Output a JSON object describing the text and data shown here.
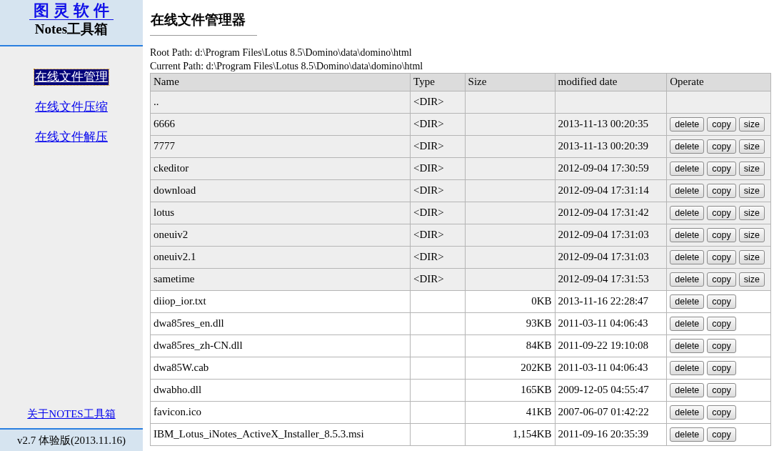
{
  "sidebar": {
    "logo": "图灵软件",
    "subtitle": "Notes工具箱",
    "items": [
      {
        "label": "在线文件管理",
        "selected": true
      },
      {
        "label": "在线文件压缩",
        "selected": false
      },
      {
        "label": "在线文件解压",
        "selected": false
      }
    ],
    "about_link": "关于NOTES工具箱",
    "version": "v2.7 体验版(2013.11.16)"
  },
  "page_title": "在线文件管理器",
  "root_path": "Root Path: d:\\Program Files\\Lotus 8.5\\Domino\\data\\domino\\html",
  "current_path": "Current Path: d:\\Program Files\\Lotus 8.5\\Domino\\data\\domino\\html",
  "table": {
    "columns": [
      "Name",
      "Type",
      "Size",
      "modified date",
      "Operate"
    ],
    "rows": [
      {
        "kind": "dir",
        "name": "..",
        "type": "<DIR>",
        "size": "",
        "date": "",
        "actions": []
      },
      {
        "kind": "dir",
        "name": "6666",
        "type": "<DIR>",
        "size": "",
        "date": "2013-11-13 00:20:35",
        "actions": [
          "delete",
          "copy",
          "size"
        ]
      },
      {
        "kind": "dir",
        "name": "7777",
        "type": "<DIR>",
        "size": "",
        "date": "2013-11-13 00:20:39",
        "actions": [
          "delete",
          "copy",
          "size"
        ]
      },
      {
        "kind": "dir",
        "name": "ckeditor",
        "type": "<DIR>",
        "size": "",
        "date": "2012-09-04 17:30:59",
        "actions": [
          "delete",
          "copy",
          "size"
        ]
      },
      {
        "kind": "dir",
        "name": "download",
        "type": "<DIR>",
        "size": "",
        "date": "2012-09-04 17:31:14",
        "actions": [
          "delete",
          "copy",
          "size"
        ]
      },
      {
        "kind": "dir",
        "name": "lotus",
        "type": "<DIR>",
        "size": "",
        "date": "2012-09-04 17:31:42",
        "actions": [
          "delete",
          "copy",
          "size"
        ]
      },
      {
        "kind": "dir",
        "name": "oneuiv2",
        "type": "<DIR>",
        "size": "",
        "date": "2012-09-04 17:31:03",
        "actions": [
          "delete",
          "copy",
          "size"
        ]
      },
      {
        "kind": "dir",
        "name": "oneuiv2.1",
        "type": "<DIR>",
        "size": "",
        "date": "2012-09-04 17:31:03",
        "actions": [
          "delete",
          "copy",
          "size"
        ]
      },
      {
        "kind": "dir",
        "name": "sametime",
        "type": "<DIR>",
        "size": "",
        "date": "2012-09-04 17:31:53",
        "actions": [
          "delete",
          "copy",
          "size"
        ]
      },
      {
        "kind": "file",
        "name": "diiop_ior.txt",
        "type": "",
        "size": "0KB",
        "date": "2013-11-16 22:28:47",
        "actions": [
          "delete",
          "copy"
        ]
      },
      {
        "kind": "file",
        "name": "dwa85res_en.dll",
        "type": "",
        "size": "93KB",
        "date": "2011-03-11 04:06:43",
        "actions": [
          "delete",
          "copy"
        ]
      },
      {
        "kind": "file",
        "name": "dwa85res_zh-CN.dll",
        "type": "",
        "size": "84KB",
        "date": "2011-09-22 19:10:08",
        "actions": [
          "delete",
          "copy"
        ]
      },
      {
        "kind": "file",
        "name": "dwa85W.cab",
        "type": "",
        "size": "202KB",
        "date": "2011-03-11 04:06:43",
        "actions": [
          "delete",
          "copy"
        ]
      },
      {
        "kind": "file",
        "name": "dwabho.dll",
        "type": "",
        "size": "165KB",
        "date": "2009-12-05 04:55:47",
        "actions": [
          "delete",
          "copy"
        ]
      },
      {
        "kind": "file",
        "name": "favicon.ico",
        "type": "",
        "size": "41KB",
        "date": "2007-06-07 01:42:22",
        "actions": [
          "delete",
          "copy"
        ]
      },
      {
        "kind": "file",
        "name": "IBM_Lotus_iNotes_ActiveX_Installer_8.5.3.msi",
        "type": "",
        "size": "1,154KB",
        "date": "2011-09-16 20:35:39",
        "actions": [
          "delete",
          "copy"
        ]
      }
    ]
  }
}
